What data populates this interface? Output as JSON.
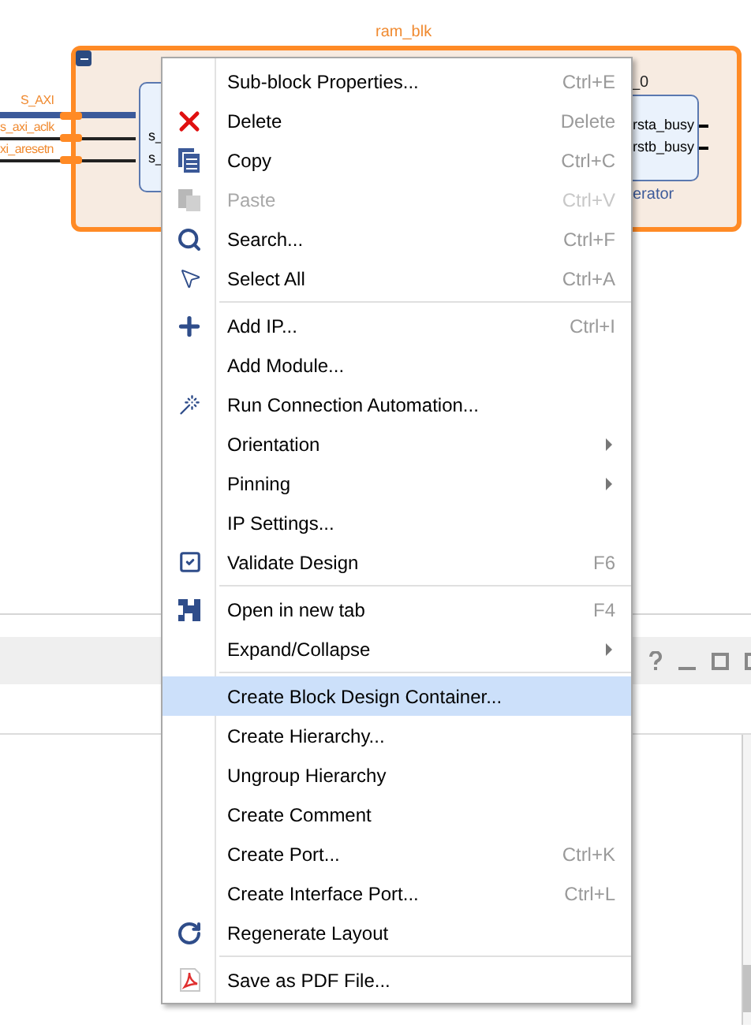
{
  "diagram": {
    "block_title": "ram_blk",
    "ports": [
      {
        "label": "S_AXI",
        "kind": "bus"
      },
      {
        "label": "s_axi_aclk",
        "kind": "clock"
      },
      {
        "label": "xi_aresetn",
        "kind": "reset"
      }
    ],
    "inner_pins": [
      "s_",
      "s_"
    ],
    "ip_block": {
      "name": "_0",
      "pins": [
        "rsta_busy",
        "rstb_busy"
      ],
      "subtitle": "erator"
    }
  },
  "context_menu": {
    "items": [
      {
        "label": "Sub-block Properties...",
        "shortcut": "Ctrl+E",
        "disabled": false,
        "selected": false,
        "submenu": false,
        "separator_after": false
      },
      {
        "label": "Delete",
        "shortcut": "Delete",
        "kind": "delete",
        "disabled": false,
        "selected": false,
        "submenu": false,
        "separator_after": false
      },
      {
        "label": "Copy",
        "shortcut": "Ctrl+C",
        "kind": "copy",
        "disabled": false,
        "selected": false,
        "submenu": false,
        "separator_after": false
      },
      {
        "label": "Paste",
        "shortcut": "Ctrl+V",
        "kind": "paste",
        "disabled": true,
        "selected": false,
        "submenu": false,
        "separator_after": false
      },
      {
        "label": "Search...",
        "shortcut": "Ctrl+F",
        "kind": "search",
        "disabled": false,
        "selected": false,
        "submenu": false,
        "separator_after": false
      },
      {
        "label": "Select All",
        "shortcut": "Ctrl+A",
        "kind": "select",
        "disabled": false,
        "selected": false,
        "submenu": false,
        "separator_after": true
      },
      {
        "label": "Add IP...",
        "shortcut": "Ctrl+I",
        "kind": "add",
        "disabled": false,
        "selected": false,
        "submenu": false,
        "separator_after": false
      },
      {
        "label": "Add Module...",
        "disabled": false,
        "selected": false,
        "submenu": false,
        "separator_after": false
      },
      {
        "label": "Run Connection Automation...",
        "kind": "wand",
        "disabled": false,
        "selected": false,
        "submenu": false,
        "separator_after": false
      },
      {
        "label": "Orientation",
        "disabled": false,
        "selected": false,
        "submenu": true,
        "separator_after": false
      },
      {
        "label": "Pinning",
        "disabled": false,
        "selected": false,
        "submenu": true,
        "separator_after": false
      },
      {
        "label": "IP Settings...",
        "disabled": false,
        "selected": false,
        "submenu": false,
        "separator_after": false
      },
      {
        "label": "Validate Design",
        "shortcut": "F6",
        "kind": "validate",
        "disabled": false,
        "selected": false,
        "submenu": false,
        "separator_after": true
      },
      {
        "label": "Open in new tab",
        "shortcut": "F4",
        "kind": "newtab",
        "disabled": false,
        "selected": false,
        "submenu": false,
        "separator_after": false
      },
      {
        "label": "Expand/Collapse",
        "disabled": false,
        "selected": false,
        "submenu": true,
        "separator_after": true
      },
      {
        "label": "Create Block Design Container...",
        "disabled": false,
        "selected": true,
        "submenu": false,
        "separator_after": false
      },
      {
        "label": "Create Hierarchy...",
        "disabled": false,
        "selected": false,
        "submenu": false,
        "separator_after": false
      },
      {
        "label": "Ungroup Hierarchy",
        "disabled": false,
        "selected": false,
        "submenu": false,
        "separator_after": false
      },
      {
        "label": "Create Comment",
        "disabled": false,
        "selected": false,
        "submenu": false,
        "separator_after": false
      },
      {
        "label": "Create Port...",
        "shortcut": "Ctrl+K",
        "disabled": false,
        "selected": false,
        "submenu": false,
        "separator_after": false
      },
      {
        "label": "Create Interface Port...",
        "shortcut": "Ctrl+L",
        "disabled": false,
        "selected": false,
        "submenu": false,
        "separator_after": false
      },
      {
        "label": "Regenerate Layout",
        "kind": "refresh",
        "disabled": false,
        "selected": false,
        "submenu": false,
        "separator_after": true
      },
      {
        "label": "Save as PDF File...",
        "kind": "pdf",
        "disabled": false,
        "selected": false,
        "submenu": false,
        "separator_after": false
      }
    ]
  }
}
